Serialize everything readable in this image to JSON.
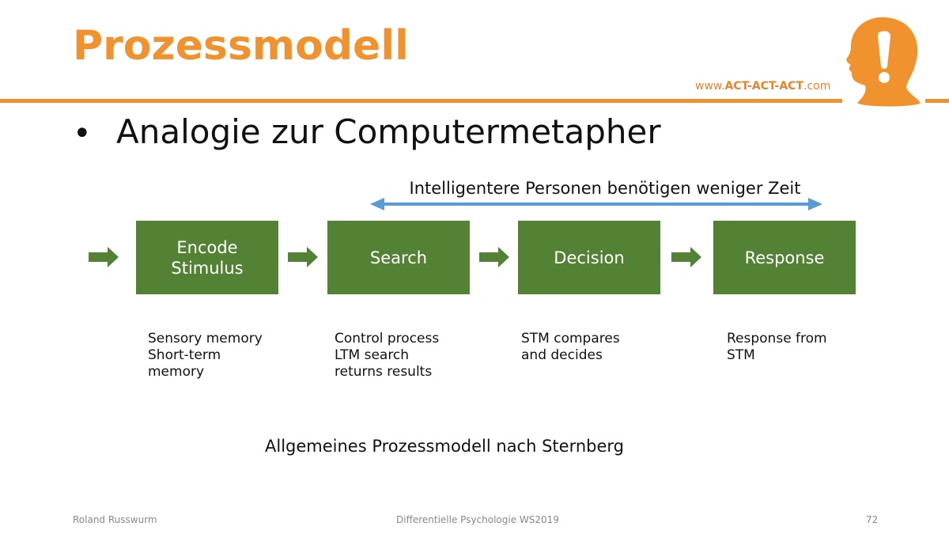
{
  "slide": {
    "title": "Prozessmodell",
    "website": {
      "prefix": "www.",
      "brand": "ACT-ACT-ACT",
      "suffix": ".com"
    },
    "logo_icon": "head-exclamation-icon",
    "bullet_symbol": "•",
    "bullet_text": "Analogie zur Computermetapher",
    "range_label": "Intelligentere Personen benötigen weniger Zeit",
    "steps": [
      {
        "label": "Encode\nStimulus",
        "description": "Sensory memory\nShort-term\nmemory"
      },
      {
        "label": "Search",
        "description": "Control process\nLTM search\nreturns results"
      },
      {
        "label": "Decision",
        "description": "STM compares\nand decides"
      },
      {
        "label": "Response",
        "description": "Response from\nSTM"
      }
    ],
    "caption": "Allgemeines Prozessmodell nach Sternberg"
  },
  "footer": {
    "author": "Roland Russwurm",
    "course": "Differentielle Psychologie WS2019",
    "page_number": "72"
  },
  "colors": {
    "accent_orange": "#f0922e",
    "box_green": "#548235",
    "range_arrow_blue": "#5b9bd5"
  }
}
